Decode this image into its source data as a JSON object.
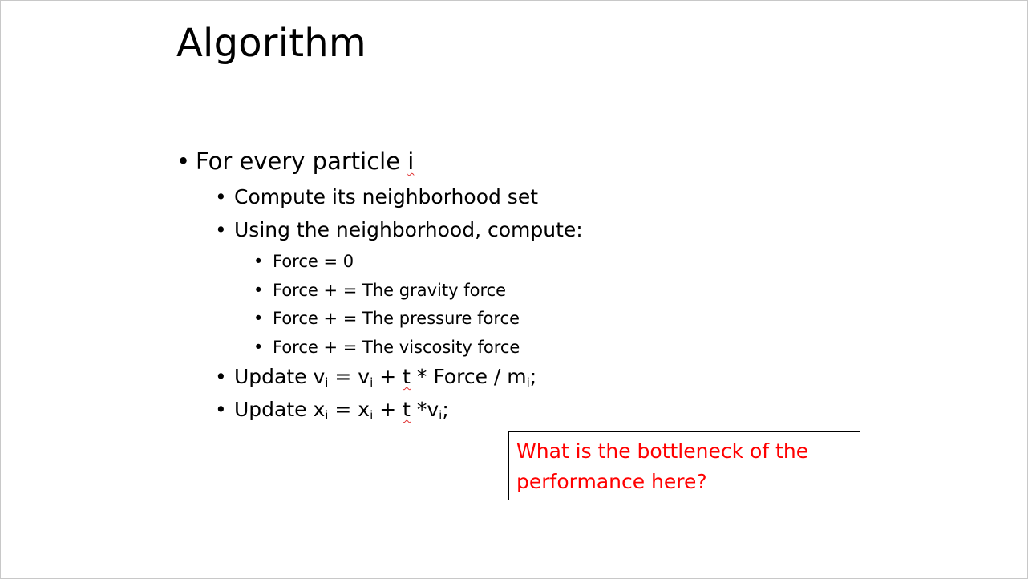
{
  "slide": {
    "title": "Algorithm",
    "bullet_char": "•",
    "items": {
      "for_every": {
        "text": "For every particle ",
        "var": "i"
      },
      "compute_set": {
        "text": "Compute its neighborhood set"
      },
      "using": {
        "text": "Using the neighborhood, compute:"
      },
      "force0": {
        "text": "Force = 0"
      },
      "gravity": {
        "text": "Force + = The gravity force"
      },
      "pressure": {
        "text": "Force + = The pressure force"
      },
      "viscosity": {
        "text": "Force + = The viscosity force"
      },
      "update_v": {
        "p1": "Update v",
        "s1": "i",
        "p2": " = v",
        "s2": "i",
        "p3": " + ",
        "t": "t",
        "p4": " * Force / m",
        "s3": "i",
        "p5": ";"
      },
      "update_x": {
        "p1": "Update x",
        "s1": "i",
        "p2": " = x",
        "s2": "i",
        "p3": " + ",
        "t": "t",
        "p4": " *v",
        "s3": "i",
        "p5": ";"
      }
    },
    "callout": {
      "text": "What is the bottleneck of the performance here?",
      "color": "#ff0000"
    }
  }
}
